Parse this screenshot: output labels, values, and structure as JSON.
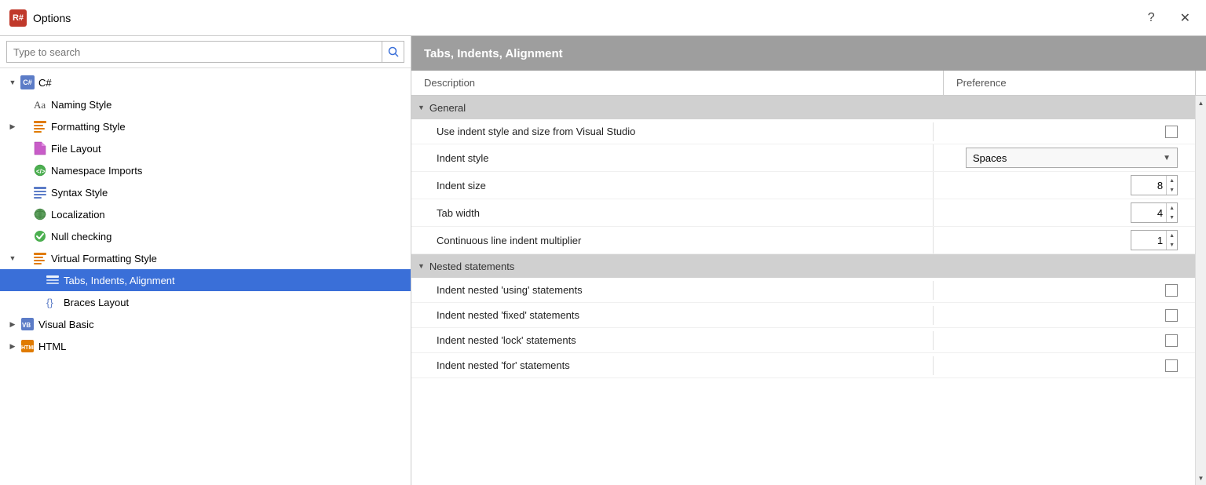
{
  "titlebar": {
    "icon_label": "R#",
    "title": "Options",
    "help_btn": "?",
    "close_btn": "✕"
  },
  "search": {
    "placeholder": "Type to search",
    "icon": "🔍"
  },
  "tree": {
    "items": [
      {
        "id": "csharp",
        "label": "C#",
        "indent": 0,
        "expanded": true,
        "has_expand": true,
        "icon_type": "csharp"
      },
      {
        "id": "naming",
        "label": "Naming Style",
        "indent": 1,
        "expanded": false,
        "has_expand": false,
        "icon_type": "naming"
      },
      {
        "id": "formatting",
        "label": "Formatting Style",
        "indent": 1,
        "expanded": false,
        "has_expand": true,
        "icon_type": "formatting"
      },
      {
        "id": "filelayout",
        "label": "File Layout",
        "indent": 1,
        "expanded": false,
        "has_expand": false,
        "icon_type": "file"
      },
      {
        "id": "namespace",
        "label": "Namespace Imports",
        "indent": 1,
        "expanded": false,
        "has_expand": false,
        "icon_type": "namespace"
      },
      {
        "id": "syntax",
        "label": "Syntax Style",
        "indent": 1,
        "expanded": false,
        "has_expand": false,
        "icon_type": "syntax"
      },
      {
        "id": "localization",
        "label": "Localization",
        "indent": 1,
        "expanded": false,
        "has_expand": false,
        "icon_type": "localization"
      },
      {
        "id": "nullchecking",
        "label": "Null checking",
        "indent": 1,
        "expanded": false,
        "has_expand": false,
        "icon_type": "null"
      },
      {
        "id": "virtualfmt",
        "label": "Virtual Formatting Style",
        "indent": 1,
        "expanded": true,
        "has_expand": true,
        "icon_type": "virtualfmt"
      },
      {
        "id": "tabsindents",
        "label": "Tabs, Indents, Alignment",
        "indent": 2,
        "expanded": false,
        "has_expand": false,
        "icon_type": "tabs",
        "selected": true
      },
      {
        "id": "braces",
        "label": "Braces Layout",
        "indent": 2,
        "expanded": false,
        "has_expand": false,
        "icon_type": "braces"
      },
      {
        "id": "visualbasic",
        "label": "Visual Basic",
        "indent": 0,
        "expanded": false,
        "has_expand": true,
        "icon_type": "vbasic"
      },
      {
        "id": "html",
        "label": "HTML",
        "indent": 0,
        "expanded": false,
        "has_expand": true,
        "icon_type": "html"
      }
    ]
  },
  "right_panel": {
    "header": "Tabs, Indents, Alignment",
    "col_description": "Description",
    "col_preference": "Preference",
    "sections": [
      {
        "id": "general",
        "label": "General",
        "expanded": true,
        "settings": [
          {
            "id": "use_indent_style",
            "description": "Use indent style and size from Visual Studio",
            "pref_type": "checkbox",
            "checked": false
          },
          {
            "id": "indent_style",
            "description": "Indent style",
            "pref_type": "dropdown",
            "value": "Spaces"
          },
          {
            "id": "indent_size",
            "description": "Indent size",
            "pref_type": "spinner",
            "value": "8"
          },
          {
            "id": "tab_width",
            "description": "Tab width",
            "pref_type": "spinner",
            "value": "4"
          },
          {
            "id": "continuous_line",
            "description": "Continuous line indent multiplier",
            "pref_type": "spinner",
            "value": "1"
          }
        ]
      },
      {
        "id": "nested",
        "label": "Nested statements",
        "expanded": true,
        "settings": [
          {
            "id": "indent_using",
            "description": "Indent nested 'using' statements",
            "pref_type": "checkbox",
            "checked": false
          },
          {
            "id": "indent_fixed",
            "description": "Indent nested 'fixed' statements",
            "pref_type": "checkbox",
            "checked": false
          },
          {
            "id": "indent_lock",
            "description": "Indent nested 'lock' statements",
            "pref_type": "checkbox",
            "checked": false
          },
          {
            "id": "indent_for",
            "description": "Indent nested 'for' statements",
            "pref_type": "checkbox",
            "checked": false
          }
        ]
      }
    ]
  }
}
